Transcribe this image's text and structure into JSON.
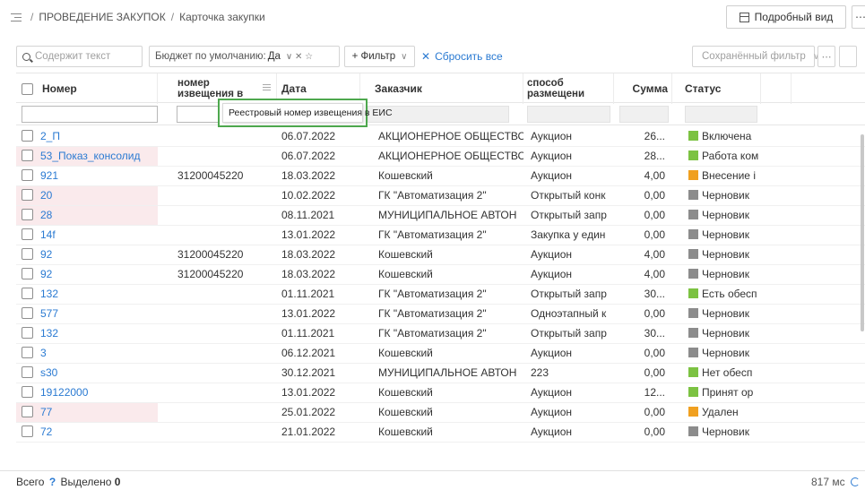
{
  "breadcrumb": {
    "section": "ПРОВЕДЕНИЕ ЗАКУПОК",
    "page": "Карточка закупки",
    "separator": "/"
  },
  "header": {
    "detail_button": "Подробный вид",
    "more": "⋯"
  },
  "filters": {
    "search_placeholder": "Содержит текст",
    "budget_label": "Бюджет по умолчанию:",
    "budget_value": "Да",
    "budget_controls": "∨ ✕ ☆",
    "add_filter": "+ Фильтр",
    "add_filter_chevron": "∨",
    "reset": "Сбросить все",
    "reset_icon": "✕",
    "saved_filter": "Сохранённый фильтр",
    "saved_chevron": "∨",
    "saved_more": "⋯"
  },
  "table": {
    "columns": {
      "num": "Номер",
      "notice_line1": "номер",
      "notice_line2": "извещения в",
      "date": "Дата",
      "customer": "Заказчик",
      "method_line1": "способ",
      "method_line2": "размещени",
      "sum": "Сумма",
      "status": "Статус"
    },
    "tooltip": "Реестровый номер извещения в ЕИС",
    "rows": [
      {
        "num": "2_П",
        "notice": "",
        "date": "06.07.2022",
        "customer": "АКЦИОНЕРНОЕ ОБЩЕСТВС",
        "method": "Аукцион",
        "sum": "26...",
        "status": "Включена",
        "status_color": "#7cc242",
        "highlight": false
      },
      {
        "num": "53_Показ_консолид",
        "notice": "",
        "date": "06.07.2022",
        "customer": "АКЦИОНЕРНОЕ ОБЩЕСТВС",
        "method": "Аукцион",
        "sum": "28...",
        "status": "Работа ком",
        "status_color": "#7cc242",
        "highlight": true
      },
      {
        "num": "921",
        "notice": "31200045220",
        "date": "18.03.2022",
        "customer": "Кошевский",
        "method": "Аукцион",
        "sum": "4,00",
        "status": "Внесение i",
        "status_color": "#f0a020",
        "highlight": false
      },
      {
        "num": "20",
        "notice": "",
        "date": "10.02.2022",
        "customer": "ГК \"Автоматизация 2\"",
        "method": "Открытый конк",
        "sum": "0,00",
        "status": "Черновик",
        "status_color": "#8c8c8c",
        "highlight": true
      },
      {
        "num": "28",
        "notice": "",
        "date": "08.11.2021",
        "customer": "МУНИЦИПАЛЬНОЕ АВТОН",
        "method": "Открытый запр",
        "sum": "0,00",
        "status": "Черновик",
        "status_color": "#8c8c8c",
        "highlight": true
      },
      {
        "num": "14f",
        "notice": "",
        "date": "13.01.2022",
        "customer": "ГК \"Автоматизация 2\"",
        "method": "Закупка у един",
        "sum": "0,00",
        "status": "Черновик",
        "status_color": "#8c8c8c",
        "highlight": false
      },
      {
        "num": "92",
        "notice": "31200045220",
        "date": "18.03.2022",
        "customer": "Кошевский",
        "method": "Аукцион",
        "sum": "4,00",
        "status": "Черновик",
        "status_color": "#8c8c8c",
        "highlight": false
      },
      {
        "num": "92",
        "notice": "31200045220",
        "date": "18.03.2022",
        "customer": "Кошевский",
        "method": "Аукцион",
        "sum": "4,00",
        "status": "Черновик",
        "status_color": "#8c8c8c",
        "highlight": false
      },
      {
        "num": "132",
        "notice": "",
        "date": "01.11.2021",
        "customer": "ГК \"Автоматизация 2\"",
        "method": "Открытый запр",
        "sum": "30...",
        "status": "Есть обесп",
        "status_color": "#7cc242",
        "highlight": false
      },
      {
        "num": "577",
        "notice": "",
        "date": "13.01.2022",
        "customer": "ГК \"Автоматизация 2\"",
        "method": "Одноэтапный к",
        "sum": "0,00",
        "status": "Черновик",
        "status_color": "#8c8c8c",
        "highlight": false
      },
      {
        "num": "132",
        "notice": "",
        "date": "01.11.2021",
        "customer": "ГК \"Автоматизация 2\"",
        "method": "Открытый запр",
        "sum": "30...",
        "status": "Черновик",
        "status_color": "#8c8c8c",
        "highlight": false
      },
      {
        "num": "3",
        "notice": "",
        "date": "06.12.2021",
        "customer": "Кошевский",
        "method": "Аукцион",
        "sum": "0,00",
        "status": "Черновик",
        "status_color": "#8c8c8c",
        "highlight": false
      },
      {
        "num": "s30",
        "notice": "",
        "date": "30.12.2021",
        "customer": "МУНИЦИПАЛЬНОЕ АВТОН",
        "method": "223",
        "sum": "0,00",
        "status": "Нет обесп",
        "status_color": "#7cc242",
        "highlight": false
      },
      {
        "num": "19122000",
        "notice": "",
        "date": "13.01.2022",
        "customer": "Кошевский",
        "method": "Аукцион",
        "sum": "12...",
        "status": "Принят ор",
        "status_color": "#7cc242",
        "highlight": false
      },
      {
        "num": "77",
        "notice": "",
        "date": "25.01.2022",
        "customer": "Кошевский",
        "method": "Аукцион",
        "sum": "0,00",
        "status": "Удален",
        "status_color": "#f0a020",
        "highlight": true
      },
      {
        "num": "72",
        "notice": "",
        "date": "21.01.2022",
        "customer": "Кошевский",
        "method": "Аукцион",
        "sum": "0,00",
        "status": "Черновик",
        "status_color": "#8c8c8c",
        "highlight": false
      }
    ]
  },
  "footer": {
    "total_label": "Всего",
    "total_value": "?",
    "selected_label": "Выделено",
    "selected_value": "0",
    "timing": "817 мс"
  }
}
